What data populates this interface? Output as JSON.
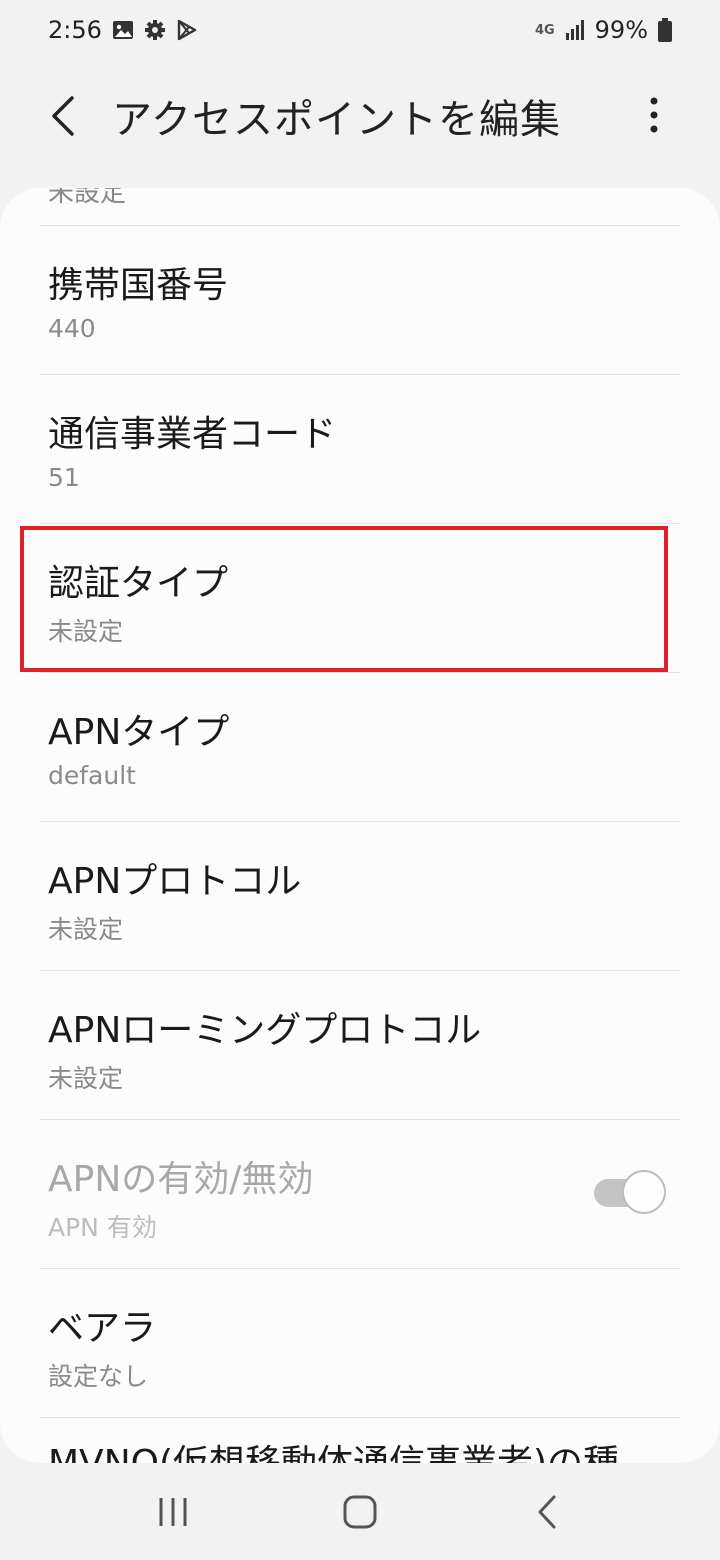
{
  "status_bar": {
    "time": "2:56",
    "icons_left": [
      "gallery-icon",
      "gear-icon",
      "play-store-icon"
    ],
    "network": "4G",
    "battery": "99%"
  },
  "app_bar": {
    "title": "アクセスポイントを編集"
  },
  "list": {
    "peek_top": "未設定",
    "items": [
      {
        "title": "携帯国番号",
        "value": "440"
      },
      {
        "title": "通信事業者コード",
        "value": "51"
      },
      {
        "title": "認証タイプ",
        "value": "未設定"
      },
      {
        "title": "APNタイプ",
        "value": "default"
      },
      {
        "title": "APNプロトコル",
        "value": "未設定"
      },
      {
        "title": "APNローミングプロトコル",
        "value": "未設定"
      },
      {
        "title": "APNの有効/無効",
        "value": "APN 有効",
        "disabled": true,
        "toggle": "on"
      },
      {
        "title": "ベアラ",
        "value": "設定なし"
      }
    ],
    "peek_bottom": "MVNO(仮想移動体通信事業者)の種"
  },
  "colors": {
    "highlight": "#e0202a",
    "background": "#f2f2f2",
    "card": "#fcfcfc"
  }
}
